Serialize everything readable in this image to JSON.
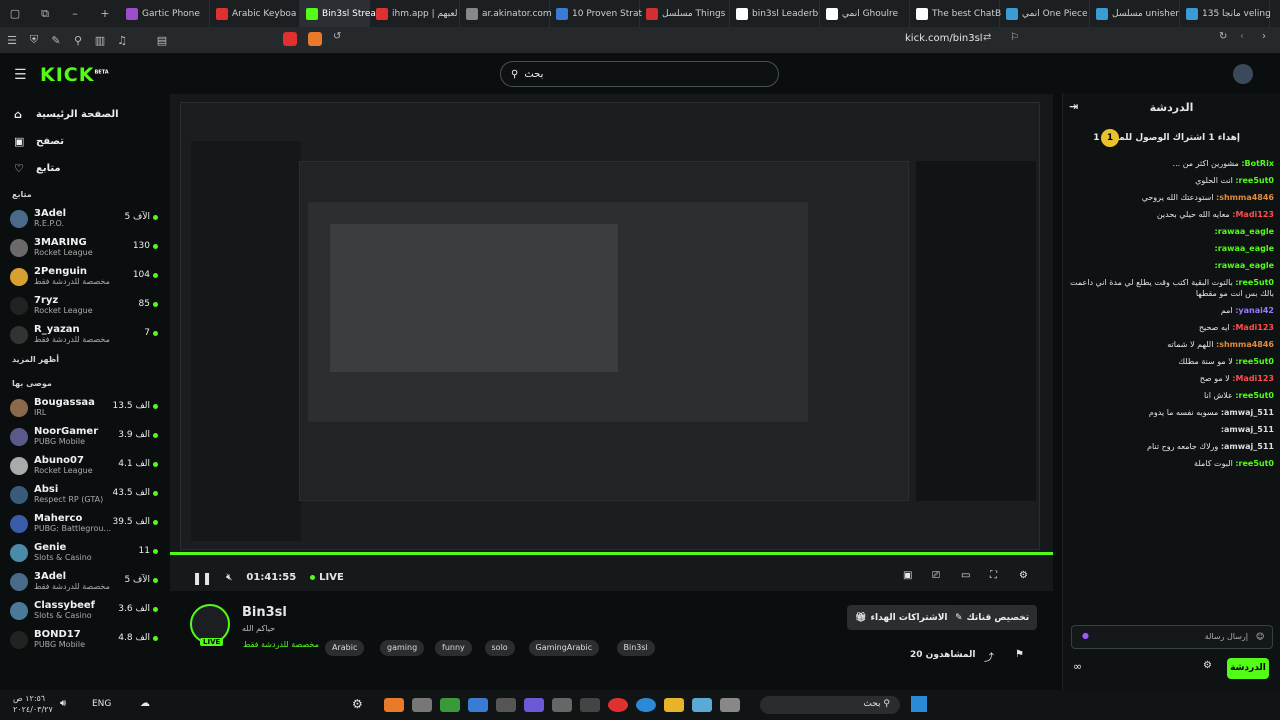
{
  "browser": {
    "tabs": [
      {
        "label": "Gartic Phone",
        "color": "#9b4dca"
      },
      {
        "label": "Arabic Keyboa",
        "color": "#e03030"
      },
      {
        "label": "Bin3sl Strea",
        "color": "#53fc18",
        "active": true
      },
      {
        "label": "ihm.app | لعبهم",
        "color": "#e03030"
      },
      {
        "label": "ar.akinator.com",
        "color": "#888888"
      },
      {
        "label": "10 Proven Strat",
        "color": "#3a7bd5"
      },
      {
        "label": "مسلسل Things",
        "color": "#d03030"
      },
      {
        "label": "bin3sl Leaderb",
        "color": "#ffffff"
      },
      {
        "label": "انمي Ghoulre",
        "color": "#ffffff"
      },
      {
        "label": "The best ChatB",
        "color": "#ffffff"
      },
      {
        "label": "انمي One Piece",
        "color": "#3a9bd5"
      },
      {
        "label": "مسلسل unisher",
        "color": "#3a9bd5"
      },
      {
        "label": "مانجا 135 veling",
        "color": "#3a9bd5"
      }
    ],
    "url": "kick.com/bin3sl"
  },
  "header": {
    "logo": "KICK",
    "logo_sup": "BETA",
    "search_placeholder": "بحث"
  },
  "sidebar": {
    "nav": [
      {
        "label": "الصفحة الرئيسية",
        "icon": "home-icon"
      },
      {
        "label": "تصفح",
        "icon": "browse-icon"
      },
      {
        "label": "متابع",
        "icon": "heart-icon"
      }
    ],
    "following_title": "متابع",
    "following": [
      {
        "name": "3Adel",
        "cat": "R.E.P.O.",
        "viewers": "5 الآف",
        "color": "#4a6a8a"
      },
      {
        "name": "3MARING",
        "cat": "Rocket League",
        "viewers": "130",
        "color": "#6a6a6a"
      },
      {
        "name": "2Penguin",
        "cat": "مخصصة للدردشة فقط",
        "viewers": "104",
        "color": "#d8a030"
      },
      {
        "name": "7ryz",
        "cat": "Rocket League",
        "viewers": "85",
        "color": "#222222"
      },
      {
        "name": "R_yazan",
        "cat": "مخصصة للدردشة فقط",
        "viewers": "7",
        "color": "#333333"
      }
    ],
    "show_more": "أظهر المزيد",
    "recommended_title": "موصى بها",
    "recommended": [
      {
        "name": "Bougassaa",
        "cat": "IRL",
        "viewers": "13.5 الف",
        "color": "#8a6a4a"
      },
      {
        "name": "NoorGamer",
        "cat": "PUBG Mobile",
        "viewers": "3.9 الف",
        "color": "#5a5a8a"
      },
      {
        "name": "Abuno07",
        "cat": "Rocket League",
        "viewers": "4.1 الف",
        "color": "#aaaaaa"
      },
      {
        "name": "Absi",
        "cat": "Respect RP (GTA)",
        "viewers": "43.5 الف",
        "color": "#3a5a7a"
      },
      {
        "name": "Maherco",
        "cat": "PUBG: Battlegrou...",
        "viewers": "39.5 الف",
        "color": "#3a5aaa"
      },
      {
        "name": "Genie",
        "cat": "Slots & Casino",
        "viewers": "11",
        "color": "#4a8aaa"
      },
      {
        "name": "3Adel",
        "cat": "مخصصة للدردشة فقط",
        "viewers": "5 الآف",
        "color": "#4a6a8a"
      },
      {
        "name": "Classybeef",
        "cat": "Slots & Casino",
        "viewers": "3.6 الف",
        "color": "#4a7a9a"
      },
      {
        "name": "BOND17",
        "cat": "PUBG Mobile",
        "viewers": "4.8 الف",
        "color": "#222222"
      }
    ]
  },
  "player": {
    "time": "01:41:55",
    "live_label": "LIVE"
  },
  "stream": {
    "name": "Bin3sl",
    "subtitle": "حياكم الله",
    "category": "مخصصة للدردشة فقط",
    "live_badge": "LIVE",
    "tags": [
      "Arabic",
      "gaming",
      "funny",
      "solo",
      "GamingArabic",
      "Bin3sl"
    ],
    "customize_label": "تخصيص قناتك",
    "gift_subs_label": "الاشتراكات الهداء",
    "viewers_label": "المشاهدون 20"
  },
  "chat": {
    "title": "الدردشة",
    "pinned": "إهداء 1 اشتراك الوصول للمركز 1",
    "pinned_rank": "1",
    "messages": [
      {
        "user": "BotRix:",
        "color": "#53fc18",
        "text": "مشورين اكثر من ..."
      },
      {
        "user": "ree5ut0:",
        "color": "#53fc18",
        "text": "انت الحلوي"
      },
      {
        "user": "shmma4846:",
        "color": "#e28b3c",
        "text": "استودعتك الله يروحي"
      },
      {
        "user": "Madi123:",
        "color": "#ff4d4d",
        "text": "معايه الله حيلي بحدين"
      },
      {
        "user": "rawaa_eagle:",
        "color": "#53fc18",
        "text": ""
      },
      {
        "user": "rawaa_eagle:",
        "color": "#53fc18",
        "text": ""
      },
      {
        "user": "rawaa_eagle:",
        "color": "#53fc18",
        "text": ""
      },
      {
        "user": "ree5ut0:",
        "color": "#53fc18",
        "text": "بالتوت البقية اكتب وقت يطلع لي مدة اني داعمت بالك بس انت مو مقطها"
      },
      {
        "user": "yanai42:",
        "color": "#9a7aff",
        "text": "امم"
      },
      {
        "user": "Madi123:",
        "color": "#ff4d4d",
        "text": "ايه صحيح"
      },
      {
        "user": "shmma4846:",
        "color": "#e28b3c",
        "text": "اللهم لا شماته"
      },
      {
        "user": "ree5ut0:",
        "color": "#53fc18",
        "text": "لا مو سنة مطلك"
      },
      {
        "user": "Madi123:",
        "color": "#ff4d4d",
        "text": "لا مو صح"
      },
      {
        "user": "ree5ut0:",
        "color": "#53fc18",
        "text": "علاش انا"
      },
      {
        "user": "amwaj_511:",
        "color": "#dddddd",
        "text": "مسوبه نفسه ما يدوم"
      },
      {
        "user": "amwaj_511:",
        "color": "#dddddd",
        "text": ""
      },
      {
        "user": "amwaj_511:",
        "color": "#dddddd",
        "text": "ورلاك جامعه روح تنام"
      },
      {
        "user": "ree5ut0:",
        "color": "#53fc18",
        "text": "البوت كاملة"
      }
    ],
    "input_placeholder": "إرسال رسالة",
    "send_label": "الدردشة"
  },
  "taskbar": {
    "lang": "ENG",
    "clock": "١٢:٥٦ ص",
    "date": "٢٠٢٤/٠٣/٢٧",
    "search": "بحث"
  }
}
